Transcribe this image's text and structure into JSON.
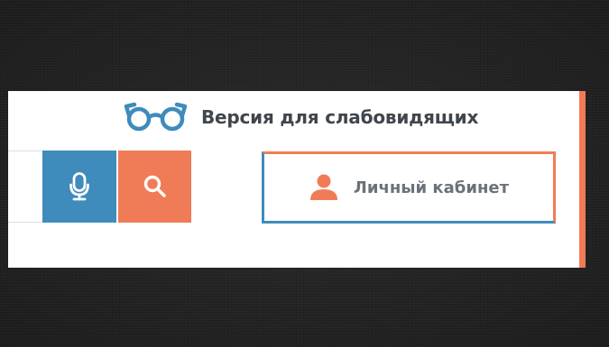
{
  "header": {
    "accessibility_link": {
      "label": "Версия для слабовидящих",
      "icon": "glasses-icon"
    },
    "search": {
      "value": "",
      "voice_button_icon": "microphone-icon",
      "search_button_icon": "search-icon"
    },
    "account_button": {
      "label": "Личный кабинет",
      "icon": "user-icon"
    }
  },
  "colors": {
    "accent_orange": "#f07c57",
    "accent_blue": "#3f8bbb",
    "text_dark": "#3f464d",
    "text_gray": "#6c7278"
  }
}
